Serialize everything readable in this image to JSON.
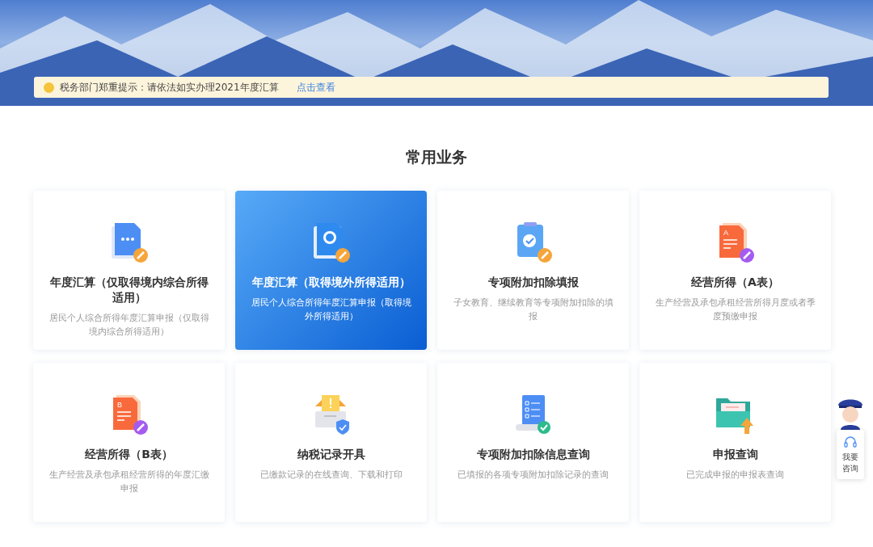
{
  "notice": {
    "text": "税务部门郑重提示：请依法如实办理2021年度汇算",
    "link": "点击查看"
  },
  "section_title": "常用业务",
  "cards": [
    {
      "kind": "doc-edit",
      "title": "年度汇算（仅取得境内综合所得适用）",
      "description": "居民个人综合所得年度汇算申报（仅取得境内综合所得适用）",
      "selected": false
    },
    {
      "kind": "globe-book",
      "title": "年度汇算（取得境外所得适用）",
      "description": "居民个人综合所得年度汇算申报（取得境外所得适用）",
      "selected": true
    },
    {
      "kind": "clipboard-check",
      "title": "专项附加扣除填报",
      "description": "子女教育、继续教育等专项附加扣除的填报",
      "selected": false
    },
    {
      "kind": "form",
      "icon_letter": "A",
      "title": "经营所得（A表）",
      "description": "生产经营及承包承租经营所得月度或者季度预缴申报",
      "selected": false
    },
    {
      "kind": "form",
      "icon_letter": "B",
      "title": "经营所得（B表）",
      "description": "生产经营及承包承租经营所得的年度汇缴申报",
      "selected": false
    },
    {
      "kind": "mailbox-shield",
      "title": "纳税记录开具",
      "description": "已缴款记录的在线查询、下载和打印",
      "selected": false
    },
    {
      "kind": "scroll-check",
      "title": "专项附加扣除信息查询",
      "description": "已填报的各项专项附加扣除记录的查询",
      "selected": false
    },
    {
      "kind": "folder-upload",
      "title": "申报查询",
      "description": "已完成申报的申报表查询",
      "selected": false
    }
  ],
  "consult": {
    "label": "我要咨询"
  }
}
